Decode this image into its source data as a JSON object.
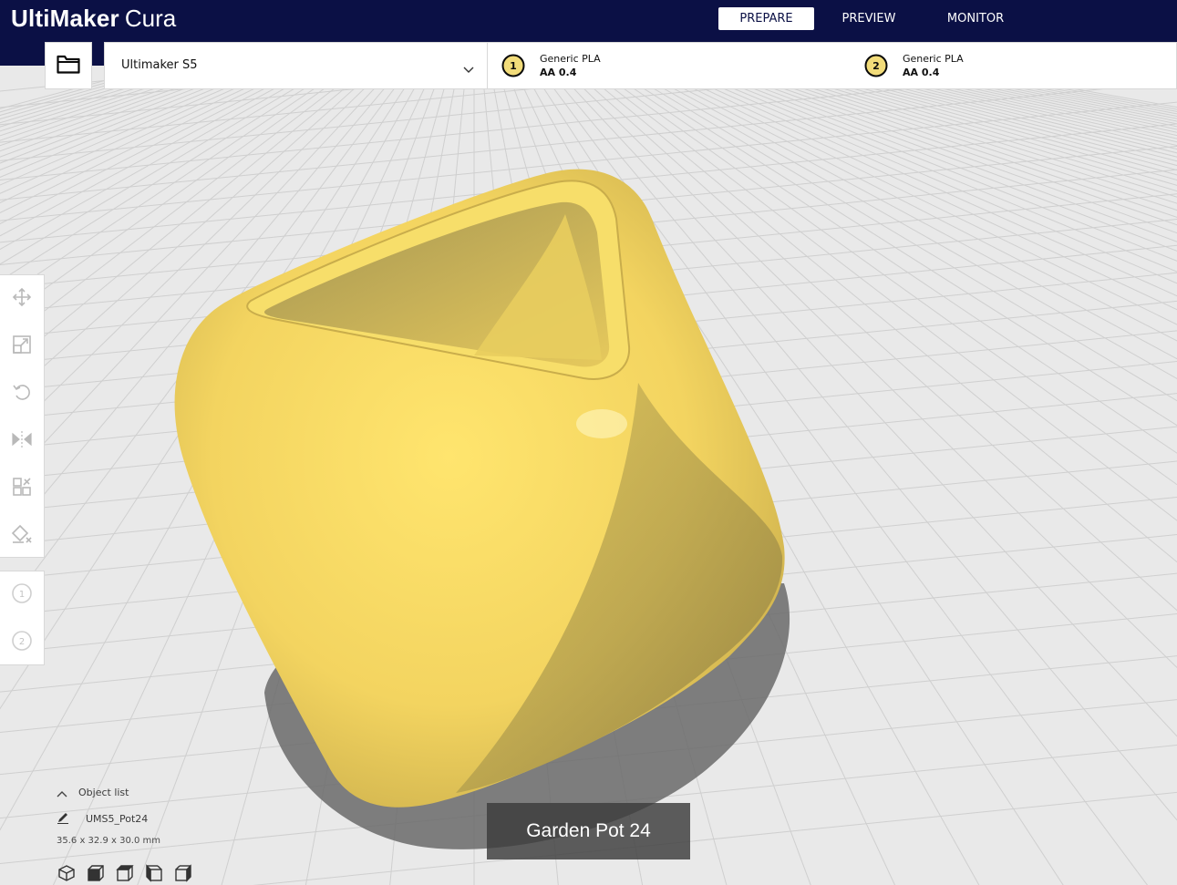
{
  "app": {
    "brand": "UltiMaker",
    "product": "Cura",
    "header_bg": "#0b1045"
  },
  "stages": {
    "prepare": "PREPARE",
    "preview": "PREVIEW",
    "monitor": "MONITOR",
    "active": "prepare"
  },
  "printer": {
    "name": "Ultimaker S5"
  },
  "extruders": [
    {
      "number": "1",
      "material": "Generic PLA",
      "nozzle": "AA 0.4"
    },
    {
      "number": "2",
      "material": "Generic PLA",
      "nozzle": "AA 0.4"
    }
  ],
  "toolbar": {
    "tools": [
      "move-icon",
      "scale-icon",
      "rotate-icon",
      "mirror-icon",
      "per-model-settings-icon",
      "support-blocker-icon"
    ],
    "extruder_buttons": [
      "1",
      "2"
    ]
  },
  "object_list": {
    "label": "Object list",
    "object_name": "UMS5_Pot24",
    "dimensions": "35.6 x 32.9 x 30.0 mm"
  },
  "view_buttons": [
    "3d-view-icon",
    "front-view-icon",
    "top-view-icon",
    "left-view-icon",
    "right-view-icon"
  ],
  "model_label": "Garden Pot 24",
  "colors": {
    "model": "#f5d76a",
    "accent": "#0b1045",
    "extruder_badge": "#f2dc7a"
  }
}
